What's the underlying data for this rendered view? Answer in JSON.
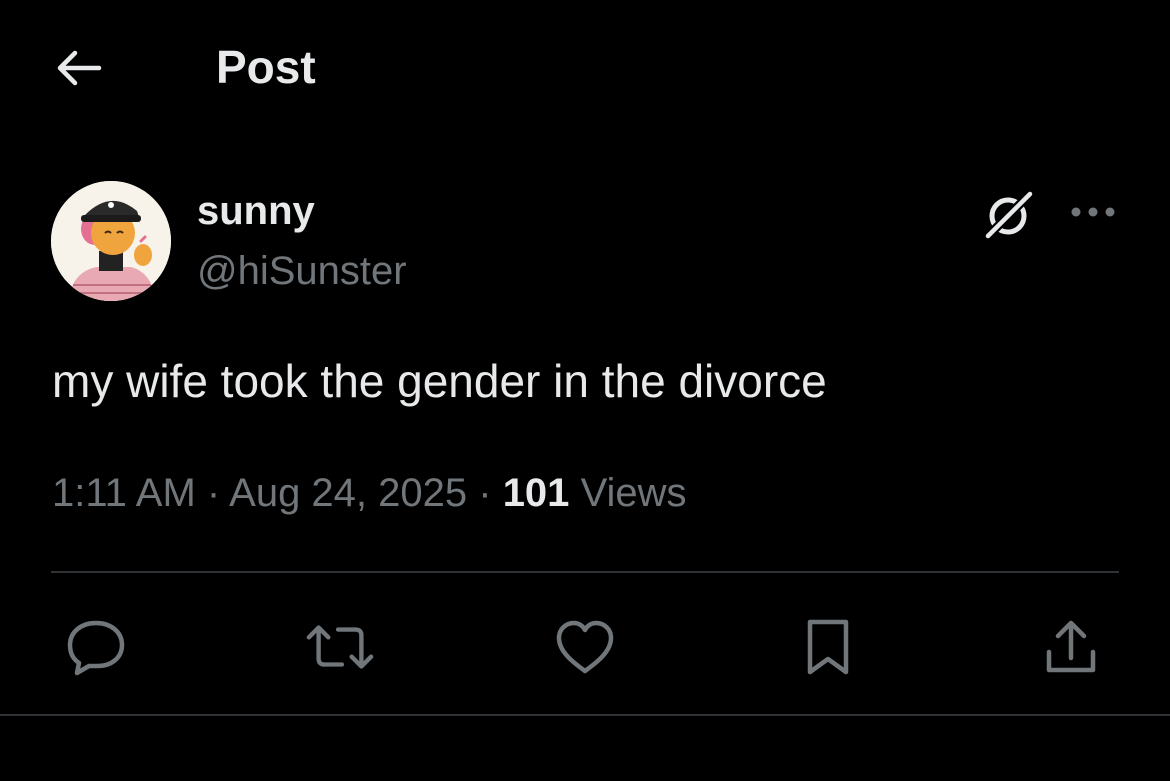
{
  "header": {
    "title": "Post"
  },
  "author": {
    "display_name": "sunny",
    "handle": "@hiSunster"
  },
  "post": {
    "text": "my wife took the gender in the divorce",
    "time": "1:11 AM",
    "separator": " · ",
    "date": "Aug 24, 2025",
    "views_count": "101",
    "views_label": "Views"
  },
  "icons": {
    "back": "arrow-left-icon",
    "grok": "grok-icon",
    "more": "more-horizontal-icon",
    "reply": "reply-icon",
    "repost": "repost-icon",
    "like": "heart-icon",
    "bookmark": "bookmark-icon",
    "share": "share-icon"
  },
  "colors": {
    "background": "#000000",
    "primary_text": "#e7e9ea",
    "secondary_text": "#71767b",
    "divider": "#2f3336"
  }
}
